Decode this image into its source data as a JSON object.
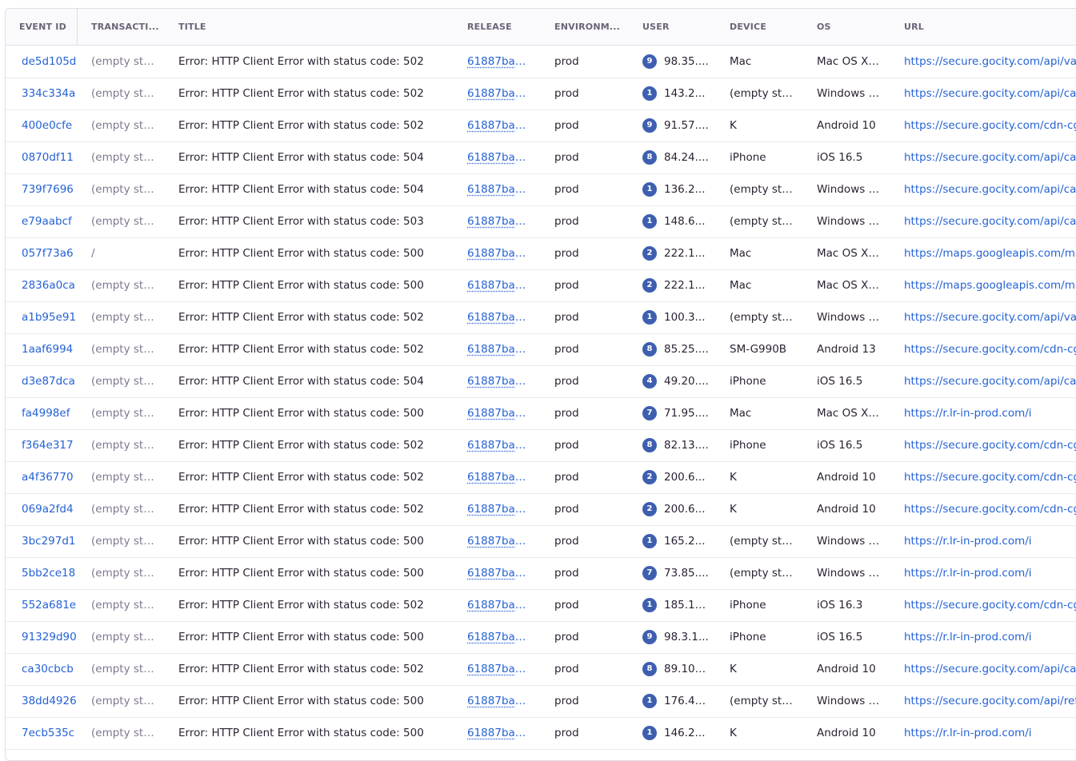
{
  "columns": [
    "EVENT ID",
    "TRANSACTI...",
    "TITLE",
    "RELEASE",
    "ENVIRONM...",
    "USER",
    "DEVICE",
    "OS",
    "URL"
  ],
  "rows": [
    {
      "id": "de5d105d",
      "txn": "(empty str...",
      "title": "Error: HTTP Client Error with status code: 502",
      "release": "61887ba7...",
      "env": "prod",
      "user_badge": "9",
      "user": "98.35....",
      "device": "Mac",
      "os": "Mac OS X ...",
      "url": "https://secure.gocity.com/api/va"
    },
    {
      "id": "334c334a",
      "txn": "(empty str...",
      "title": "Error: HTTP Client Error with status code: 502",
      "release": "61887ba7...",
      "env": "prod",
      "user_badge": "1",
      "user": "143.2...",
      "device": "(empty str...",
      "os": "Windows >...",
      "url": "https://secure.gocity.com/api/ca"
    },
    {
      "id": "400e0cfe",
      "txn": "(empty str...",
      "title": "Error: HTTP Client Error with status code: 502",
      "release": "61887ba7...",
      "env": "prod",
      "user_badge": "9",
      "user": "91.57....",
      "device": "K",
      "os": "Android 10",
      "url": "https://secure.gocity.com/cdn-cg"
    },
    {
      "id": "0870df11",
      "txn": "(empty str...",
      "title": "Error: HTTP Client Error with status code: 504",
      "release": "61887ba7...",
      "env": "prod",
      "user_badge": "8",
      "user": "84.24....",
      "device": "iPhone",
      "os": "iOS 16.5",
      "url": "https://secure.gocity.com/api/ca"
    },
    {
      "id": "739f7696",
      "txn": "(empty str...",
      "title": "Error: HTTP Client Error with status code: 504",
      "release": "61887ba7...",
      "env": "prod",
      "user_badge": "1",
      "user": "136.2...",
      "device": "(empty str...",
      "os": "Windows >...",
      "url": "https://secure.gocity.com/api/ca"
    },
    {
      "id": "e79aabcf",
      "txn": "(empty str...",
      "title": "Error: HTTP Client Error with status code: 503",
      "release": "61887ba7...",
      "env": "prod",
      "user_badge": "1",
      "user": "148.6...",
      "device": "(empty str...",
      "os": "Windows >...",
      "url": "https://secure.gocity.com/api/ca"
    },
    {
      "id": "057f73a6",
      "txn": "/",
      "title": "Error: HTTP Client Error with status code: 500",
      "release": "61887ba7...",
      "env": "prod",
      "user_badge": "2",
      "user": "222.1...",
      "device": "Mac",
      "os": "Mac OS X ...",
      "url": "https://maps.googleapis.com/ma"
    },
    {
      "id": "2836a0ca",
      "txn": "(empty str...",
      "title": "Error: HTTP Client Error with status code: 500",
      "release": "61887ba7...",
      "env": "prod",
      "user_badge": "2",
      "user": "222.1...",
      "device": "Mac",
      "os": "Mac OS X ...",
      "url": "https://maps.googleapis.com/ma"
    },
    {
      "id": "a1b95e91",
      "txn": "(empty str...",
      "title": "Error: HTTP Client Error with status code: 502",
      "release": "61887ba7...",
      "env": "prod",
      "user_badge": "1",
      "user": "100.3...",
      "device": "(empty str...",
      "os": "Windows >...",
      "url": "https://secure.gocity.com/api/va"
    },
    {
      "id": "1aaf6994",
      "txn": "(empty str...",
      "title": "Error: HTTP Client Error with status code: 502",
      "release": "61887ba7...",
      "env": "prod",
      "user_badge": "8",
      "user": "85.25....",
      "device": "SM-G990B",
      "os": "Android 13",
      "url": "https://secure.gocity.com/cdn-cg"
    },
    {
      "id": "d3e87dca",
      "txn": "(empty str...",
      "title": "Error: HTTP Client Error with status code: 504",
      "release": "61887ba7...",
      "env": "prod",
      "user_badge": "4",
      "user": "49.20....",
      "device": "iPhone",
      "os": "iOS 16.5",
      "url": "https://secure.gocity.com/api/ca"
    },
    {
      "id": "fa4998ef",
      "txn": "(empty str...",
      "title": "Error: HTTP Client Error with status code: 500",
      "release": "61887ba7...",
      "env": "prod",
      "user_badge": "7",
      "user": "71.95....",
      "device": "Mac",
      "os": "Mac OS X ...",
      "url": "https://r.lr-in-prod.com/i"
    },
    {
      "id": "f364e317",
      "txn": "(empty str...",
      "title": "Error: HTTP Client Error with status code: 502",
      "release": "61887ba7...",
      "env": "prod",
      "user_badge": "8",
      "user": "82.13....",
      "device": "iPhone",
      "os": "iOS 16.5",
      "url": "https://secure.gocity.com/cdn-cg"
    },
    {
      "id": "a4f36770",
      "txn": "(empty str...",
      "title": "Error: HTTP Client Error with status code: 502",
      "release": "61887ba7...",
      "env": "prod",
      "user_badge": "2",
      "user": "200.6...",
      "device": "K",
      "os": "Android 10",
      "url": "https://secure.gocity.com/cdn-cg"
    },
    {
      "id": "069a2fd4",
      "txn": "(empty str...",
      "title": "Error: HTTP Client Error with status code: 502",
      "release": "61887ba7...",
      "env": "prod",
      "user_badge": "2",
      "user": "200.6...",
      "device": "K",
      "os": "Android 10",
      "url": "https://secure.gocity.com/cdn-cg"
    },
    {
      "id": "3bc297d1",
      "txn": "(empty str...",
      "title": "Error: HTTP Client Error with status code: 500",
      "release": "61887ba7...",
      "env": "prod",
      "user_badge": "1",
      "user": "165.2...",
      "device": "(empty str...",
      "os": "Windows >...",
      "url": "https://r.lr-in-prod.com/i"
    },
    {
      "id": "5bb2ce18",
      "txn": "(empty str...",
      "title": "Error: HTTP Client Error with status code: 500",
      "release": "61887ba7...",
      "env": "prod",
      "user_badge": "7",
      "user": "73.85....",
      "device": "(empty str...",
      "os": "Windows >...",
      "url": "https://r.lr-in-prod.com/i"
    },
    {
      "id": "552a681e",
      "txn": "(empty str...",
      "title": "Error: HTTP Client Error with status code: 502",
      "release": "61887ba7...",
      "env": "prod",
      "user_badge": "1",
      "user": "185.10...",
      "device": "iPhone",
      "os": "iOS 16.3",
      "url": "https://secure.gocity.com/cdn-cg"
    },
    {
      "id": "91329d90",
      "txn": "(empty str...",
      "title": "Error: HTTP Client Error with status code: 500",
      "release": "61887ba7...",
      "env": "prod",
      "user_badge": "9",
      "user": "98.3.1...",
      "device": "iPhone",
      "os": "iOS 16.5",
      "url": "https://r.lr-in-prod.com/i"
    },
    {
      "id": "ca30cbcb",
      "txn": "(empty str...",
      "title": "Error: HTTP Client Error with status code: 502",
      "release": "61887ba7...",
      "env": "prod",
      "user_badge": "8",
      "user": "89.101...",
      "device": "K",
      "os": "Android 10",
      "url": "https://secure.gocity.com/api/ca"
    },
    {
      "id": "38dd4926",
      "txn": "(empty str...",
      "title": "Error: HTTP Client Error with status code: 500",
      "release": "61887ba7...",
      "env": "prod",
      "user_badge": "1",
      "user": "176.41...",
      "device": "(empty str...",
      "os": "Windows >...",
      "url": "https://secure.gocity.com/api/ref"
    },
    {
      "id": "7ecb535c",
      "txn": "(empty str...",
      "title": "Error: HTTP Client Error with status code: 500",
      "release": "61887ba7...",
      "env": "prod",
      "user_badge": "1",
      "user": "146.2...",
      "device": "K",
      "os": "Android 10",
      "url": "https://r.lr-in-prod.com/i"
    }
  ]
}
